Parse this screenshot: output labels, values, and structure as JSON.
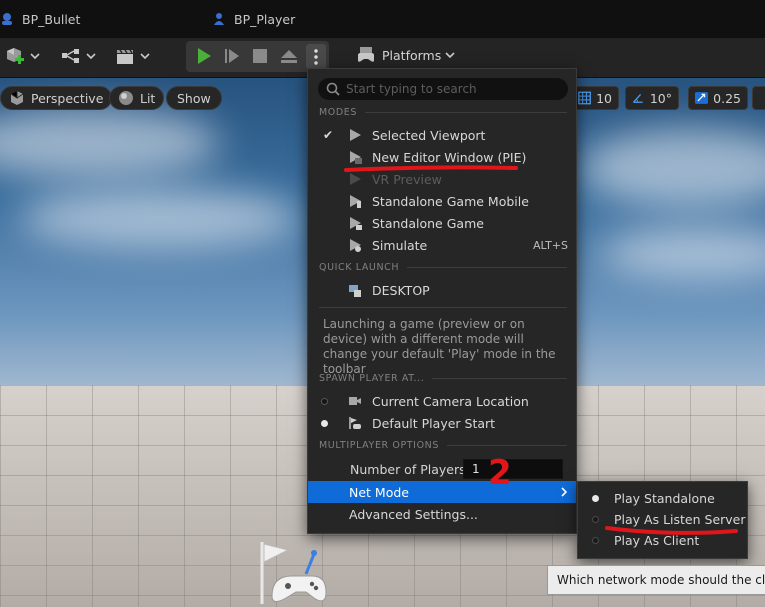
{
  "tabs": [
    {
      "label": "BP_Bullet",
      "icon": "blueprint-icon"
    },
    {
      "label": "BP_Player",
      "icon": "pawn-icon"
    }
  ],
  "toolbar": {
    "platforms_label": "Platforms"
  },
  "viewport": {
    "perspective_label": "Perspective",
    "lit_label": "Lit",
    "show_label": "Show",
    "grid_value": "10",
    "angle_value": "10°",
    "scale_value": "0.25"
  },
  "menu": {
    "search_placeholder": "Start typing to search",
    "sections": {
      "modes": "MODES",
      "quick_launch": "QUICK LAUNCH",
      "spawn": "SPAWN PLAYER AT...",
      "multiplayer": "MULTIPLAYER OPTIONS"
    },
    "modes": [
      {
        "label": "Selected Viewport",
        "checked": true,
        "icon": "viewport-play-icon"
      },
      {
        "label": "New Editor Window (PIE)",
        "checked": false,
        "icon": "window-play-icon"
      },
      {
        "label": "VR Preview",
        "checked": false,
        "disabled": true,
        "icon": "vr-icon"
      },
      {
        "label": "Standalone Game Mobile",
        "checked": false,
        "icon": "mobile-play-icon"
      },
      {
        "label": "Standalone Game",
        "checked": false,
        "icon": "standalone-play-icon"
      },
      {
        "label": "Simulate",
        "shortcut": "ALT+S",
        "icon": "simulate-icon"
      }
    ],
    "quick_launch": [
      {
        "label": "DESKTOP",
        "icon": "desktop-icon"
      }
    ],
    "hint": "Launching a game (preview or on device) with a different mode will change your default 'Play' mode in the toolbar",
    "spawn": [
      {
        "label": "Current Camera Location",
        "selected": false,
        "icon": "camera-icon"
      },
      {
        "label": "Default Player Start",
        "selected": true,
        "icon": "player-start-icon"
      }
    ],
    "number_of_players_label": "Number of Players",
    "number_of_players_value": "1",
    "net_mode_label": "Net Mode",
    "advanced_settings_label": "Advanced Settings..."
  },
  "net_mode_submenu": [
    {
      "label": "Play Standalone",
      "selected": true
    },
    {
      "label": "Play As Listen Server",
      "selected": false
    },
    {
      "label": "Play As Client",
      "selected": false
    }
  ],
  "tooltip": "Which network mode should the clients",
  "annotations": {
    "handwritten_number": "2",
    "color": "#e0161b"
  },
  "colors": {
    "highlight": "#0e6bd8",
    "play_green": "#4caf3a",
    "menu_bg": "#262626"
  }
}
